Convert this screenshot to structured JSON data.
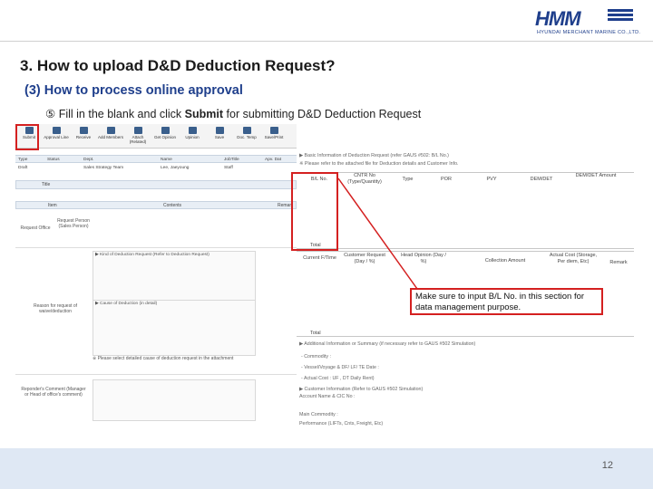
{
  "logo": {
    "brand": "HMM",
    "tagline": "HYUNDAI MERCHANT MARINE CO.,LTD."
  },
  "title": "3. How to upload D&D Deduction Request?",
  "subtitle": "(3) How to process online approval",
  "step": {
    "marker": "⑤",
    "prefix": "Fill in the blank and click",
    "bold": "Submit",
    "suffix": "for submitting D&D Deduction Request"
  },
  "toolbar": [
    "Submit",
    "Approval Line",
    "Receive",
    "Add Members",
    "Attach (Related)",
    "Get Opinion",
    "Upinion",
    "Save",
    "Doc. Temp",
    "Save/Print"
  ],
  "grid": {
    "headers": [
      "Type",
      "Status",
      "Dept.",
      "Name",
      "JobTitle",
      "Apv. Dat"
    ],
    "row": [
      "Draft",
      "",
      "Sales Strategy Team",
      "Lee, Jaeyoung",
      "Staff",
      ""
    ]
  },
  "form": {
    "title_label": "Title",
    "item_header": "Item",
    "contents_header": "Contents",
    "remarks_header": "Remar",
    "requestor_office": "Request Office",
    "request_person": "Request Person (Sales Person)",
    "reason_label": "Reason for request of waive/deduction",
    "responder_label": "Reponder's Comment (Manager or Head of office's comment)",
    "kind_section": "▶ Kind of Deduction Request (Refer to Deduction Request)",
    "cause_section": "▶ Cause of Deduction (in detail)",
    "detail_section": "※ Please select detailed cause of deduction request in the attachment"
  },
  "right_form": {
    "basic_info": "▶ Basic Information of Deduction Request (refer GAUS #502: B/L No.)",
    "basic_note": "※ Please refer to the attached file for Deduction details and Customer Info.",
    "table1_headers": [
      "B/L No.",
      "CNTR No (Type/Quantity)",
      "Type",
      "POR",
      "PVY",
      "DEM/DET",
      "DEM/DET Amount"
    ],
    "total": "Total",
    "table2_headers": [
      "Current F/Time",
      "Customer Request (Day / %)",
      "Head Opinion (Day / %)",
      "Collection Amount",
      "Actual Cost (Storage, Per diem, Etc)",
      "Remark"
    ],
    "additional": "▶ Additional Information or Summary (if necessary refer to GAUS #502 Simulation)",
    "commodity": "- Commodity :",
    "vessel": "- Vessel/Voyage & DF/ LF/ TE Date :",
    "actual_cost": "- Actual Cost : UF          , DT Daily Rent)",
    "customer_info": "▶ Customer Information (Refer to GAUS #502 Simulation)",
    "account": "Account Name & CIC No :",
    "main_commodity": "Main Commodity :",
    "performance": "Performance (LIFTs, Cnts, Freight, Etc)"
  },
  "callout": "Make sure to input B/L No. in this section for data management purpose.",
  "page_number": "12"
}
